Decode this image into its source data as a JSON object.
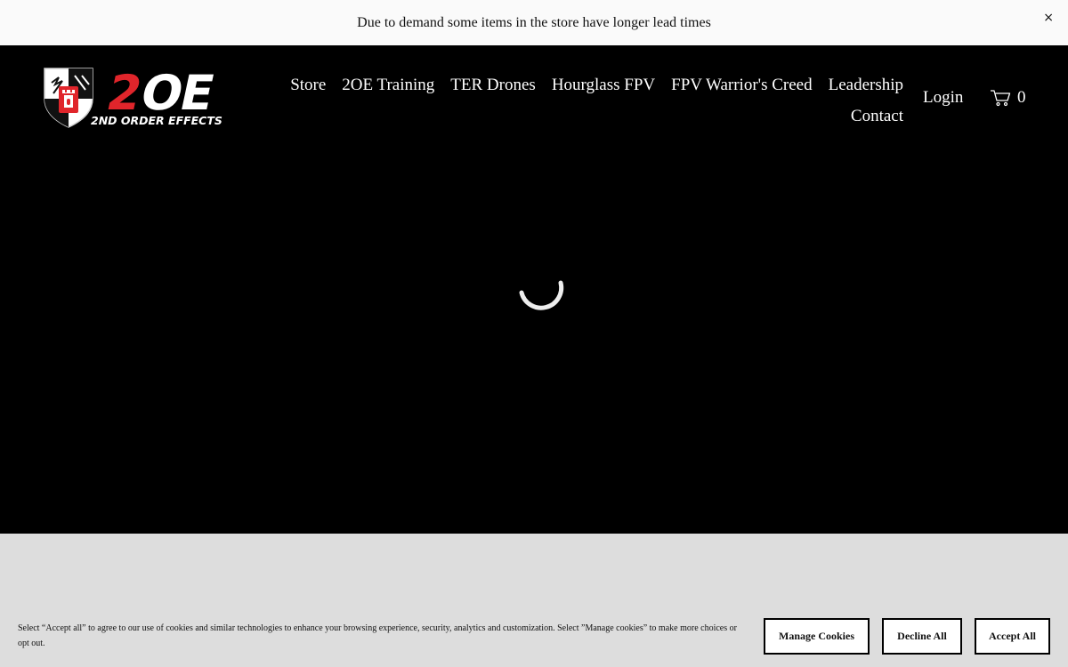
{
  "announcement": {
    "text": "Due to demand some items in the store have longer lead times",
    "close_glyph": "×"
  },
  "logo": {
    "wordmark": "2OE",
    "tagline": "2ND ORDER EFFECTS",
    "brand_red": "#e0252b"
  },
  "nav": {
    "items": [
      {
        "label": "Store"
      },
      {
        "label": "2OE Training"
      },
      {
        "label": "TER Drones"
      },
      {
        "label": "Hourglass FPV"
      },
      {
        "label": "FPV Warrior's Creed"
      },
      {
        "label": "Leadership"
      },
      {
        "label": "Contact"
      }
    ]
  },
  "account": {
    "login_label": "Login",
    "cart_icon": "cart-icon",
    "cart_count": "0"
  },
  "loading": {
    "icon": "loading-spinner-icon"
  },
  "cookie_banner": {
    "text": "Select “Accept all” to agree to our use of cookies and similar technologies to enhance your browsing experience, security, analytics and customization. Select ”Manage cookies” to make more choices or opt out.",
    "manage_label": "Manage Cookies",
    "decline_label": "Decline All",
    "accept_label": "Accept All"
  },
  "colors": {
    "announcement_bg": "#fafafa",
    "header_bg": "#000000",
    "cookie_bg": "#dddddd"
  }
}
